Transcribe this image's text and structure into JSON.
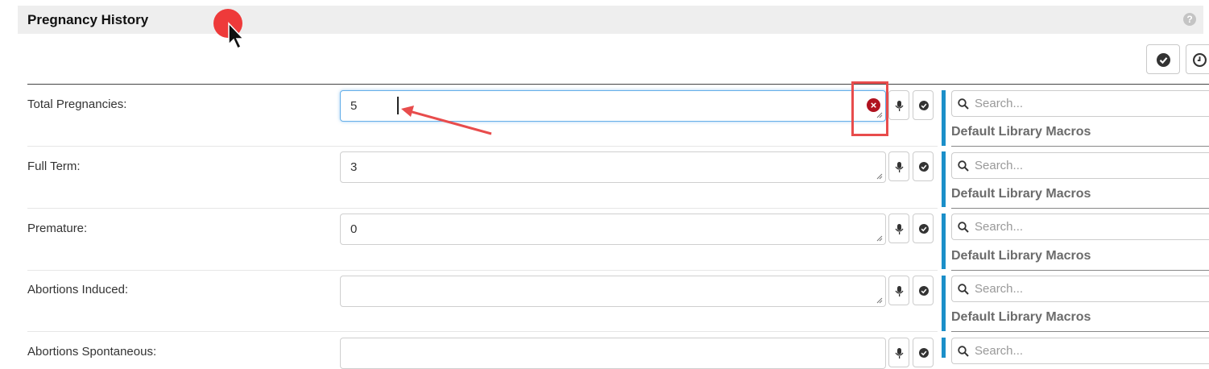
{
  "section": {
    "title": "Pregnancy History",
    "help_icon": "question-circle-icon"
  },
  "toolbar": {
    "buttons": [
      {
        "icon": "check-circle-icon"
      },
      {
        "icon": "clock-icon"
      }
    ]
  },
  "fields": [
    {
      "label": "Total Pregnancies:",
      "value": "5",
      "focused": true
    },
    {
      "label": "Full Term:",
      "value": "3"
    },
    {
      "label": "Premature:",
      "value": "0"
    },
    {
      "label": "Abortions Induced:",
      "value": ""
    },
    {
      "label": "Abortions Spontaneous:",
      "value": ""
    }
  ],
  "macros": {
    "search_placeholder": "Search...",
    "library_label": "Default Library Macros"
  },
  "colors": {
    "accent_bar": "#1b8fc9",
    "focus_border": "#66afe9",
    "annotation_red": "#e84c4c",
    "clear_icon": "#b0121f",
    "header_bg": "#eeeeee"
  }
}
